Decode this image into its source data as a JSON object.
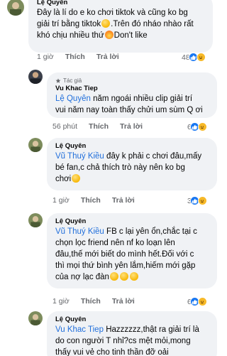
{
  "comments": [
    {
      "author": "Lệ Quyên",
      "lines": [
        "Đây là lí do e ko chơi tiktok và cũng ko bg",
        "giải trí bằng tiktok",
        ".Trên đó nháo nhào rất",
        "khó chịu nhiều thứ",
        "Don't like"
      ],
      "time": "1 giờ",
      "like": "Thích",
      "reply": "Trả lời",
      "reactions": "48"
    },
    {
      "role": "Tác giả",
      "author": "Vu Khac Tiep",
      "mention": "Lệ Quyên",
      "lines": [
        "năm ngoái nhiều clip giải trí",
        "vui năm nay toàn thấy chửi um sùm Q ơi"
      ],
      "time": "56 phút",
      "like": "Thích",
      "reply": "Trả lời",
      "reactions": "6"
    },
    {
      "author": "Lệ Quyên",
      "mention": "Vũ Thuý Kiều",
      "lines": [
        "đây k phải c chơi đâu,mấy",
        "bé fan,c chả thích trò này nên ko bg",
        "chơi"
      ],
      "time": "1 giờ",
      "like": "Thích",
      "reply": "Trả lời",
      "reactions": "3"
    },
    {
      "author": "Lệ Quyên",
      "mention": "Vũ Thuý Kiều",
      "lines": [
        "FB c lại yên ổn,chắc tại c",
        "chọn lọc friend nên nf ko loạn lên",
        "đâu,thế mới biết do mình hết.Đối với c",
        "thì mọi thứ bình yên lắm,hiếm mới gặp",
        "của nợ lạc đàn"
      ],
      "time": "1 giờ",
      "like": "Thích",
      "reply": "Trả lời",
      "reactions": "6"
    },
    {
      "author": "Lệ Quyên",
      "mention": "Vu Khac Tiep",
      "lines": [
        "Hazzzzzz,thật ra giải trí là",
        "do con người T nhỉ?cs mệt mỏi,mong",
        "thấy vui vẻ cho tinh thần đỡ oải"
      ]
    }
  ],
  "colors": {
    "bubble": "#f0f2f5",
    "mention": "#216fdb",
    "meta": "#65676b"
  },
  "icons": [
    "like-reaction-icon",
    "haha-reaction-icon",
    "love-reaction-icon",
    "author-badge-icon"
  ]
}
